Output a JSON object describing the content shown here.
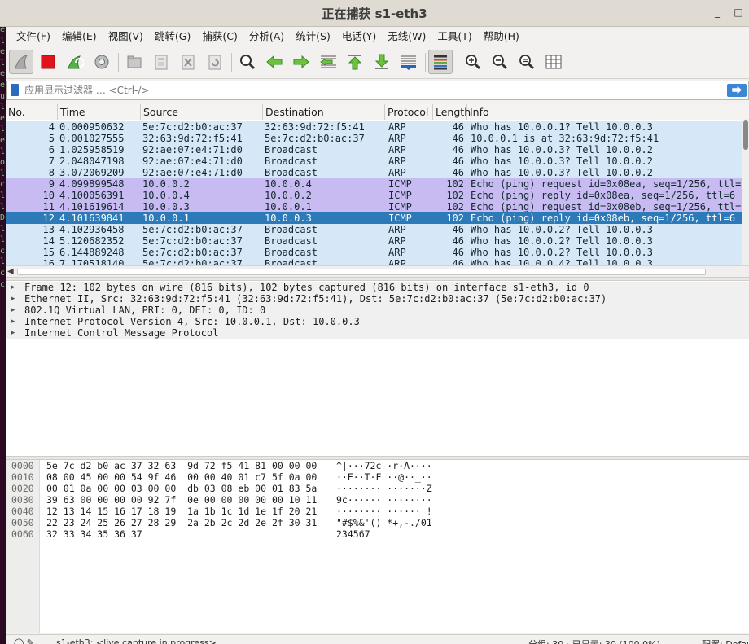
{
  "window": {
    "title": "正在捕获 s1-eth3",
    "minimize": "_",
    "close": "□"
  },
  "terminal_strip": [
    "e",
    "l",
    "e",
    "l",
    "e",
    "e",
    "",
    "u",
    "l",
    "e",
    "l",
    "e",
    "",
    "",
    "",
    "l",
    "",
    "",
    "",
    "o",
    "l",
    "c",
    "l",
    "",
    "l",
    "",
    "D",
    "l",
    "l",
    "c",
    "",
    "",
    "",
    "",
    "",
    "l",
    "c",
    "c",
    "",
    "",
    "",
    ""
  ],
  "menu": [
    {
      "label": "文件(F)"
    },
    {
      "label": "编辑(E)"
    },
    {
      "label": "视图(V)"
    },
    {
      "label": "跳转(G)"
    },
    {
      "label": "捕获(C)"
    },
    {
      "label": "分析(A)"
    },
    {
      "label": "统计(S)"
    },
    {
      "label": "电话(Y)"
    },
    {
      "label": "无线(W)"
    },
    {
      "label": "工具(T)"
    },
    {
      "label": "帮助(H)"
    }
  ],
  "toolbar": {
    "icons": [
      "start-capture-fin-icon",
      "stop-capture-icon",
      "restart-capture-icon",
      "capture-options-gear-icon",
      "open-file-icon",
      "save-file-icon",
      "close-file-icon",
      "reload-file-icon",
      "find-packet-icon",
      "go-back-icon",
      "go-forward-icon",
      "go-to-packet-icon",
      "go-first-icon",
      "go-last-icon",
      "autoscroll-icon",
      "colorize-icon",
      "zoom-in-icon",
      "zoom-out-icon",
      "zoom-normal-icon",
      "resize-columns-icon"
    ]
  },
  "filter": {
    "placeholder": "应用显示过滤器 … <Ctrl-/>",
    "apply_glyph": "⮕"
  },
  "packet_list": {
    "columns": [
      "No.",
      "Time",
      "Source",
      "Destination",
      "Protocol",
      "Length",
      "Info"
    ],
    "rows": [
      {
        "no": "4",
        "time": "0.000950632",
        "src": "5e:7c:d2:b0:ac:37",
        "dst": "32:63:9d:72:f5:41",
        "proto": "ARP",
        "len": "46",
        "info": "Who has 10.0.0.1? Tell 10.0.0.3",
        "kind": "arp"
      },
      {
        "no": "5",
        "time": "0.001027555",
        "src": "32:63:9d:72:f5:41",
        "dst": "5e:7c:d2:b0:ac:37",
        "proto": "ARP",
        "len": "46",
        "info": "10.0.0.1 is at 32:63:9d:72:f5:41",
        "kind": "arp"
      },
      {
        "no": "6",
        "time": "1.025958519",
        "src": "92:ae:07:e4:71:d0",
        "dst": "Broadcast",
        "proto": "ARP",
        "len": "46",
        "info": "Who has 10.0.0.3? Tell 10.0.0.2",
        "kind": "arp"
      },
      {
        "no": "7",
        "time": "2.048047198",
        "src": "92:ae:07:e4:71:d0",
        "dst": "Broadcast",
        "proto": "ARP",
        "len": "46",
        "info": "Who has 10.0.0.3? Tell 10.0.0.2",
        "kind": "arp"
      },
      {
        "no": "8",
        "time": "3.072069209",
        "src": "92:ae:07:e4:71:d0",
        "dst": "Broadcast",
        "proto": "ARP",
        "len": "46",
        "info": "Who has 10.0.0.3? Tell 10.0.0.2",
        "kind": "arp"
      },
      {
        "no": "9",
        "time": "4.099899548",
        "src": "10.0.0.2",
        "dst": "10.0.0.4",
        "proto": "ICMP",
        "len": "102",
        "info": "Echo (ping) request  id=0x08ea, seq=1/256, ttl=6",
        "kind": "icmp"
      },
      {
        "no": "10",
        "time": "4.100056391",
        "src": "10.0.0.4",
        "dst": "10.0.0.2",
        "proto": "ICMP",
        "len": "102",
        "info": "Echo (ping) reply    id=0x08ea, seq=1/256, ttl=6",
        "kind": "icmp"
      },
      {
        "no": "11",
        "time": "4.101619614",
        "src": "10.0.0.3",
        "dst": "10.0.0.1",
        "proto": "ICMP",
        "len": "102",
        "info": "Echo (ping) request  id=0x08eb, seq=1/256, ttl=6",
        "kind": "icmp"
      },
      {
        "no": "12",
        "time": "4.101639841",
        "src": "10.0.0.1",
        "dst": "10.0.0.3",
        "proto": "ICMP",
        "len": "102",
        "info": "Echo (ping) reply    id=0x08eb, seq=1/256, ttl=6",
        "kind": "sel"
      },
      {
        "no": "13",
        "time": "4.102936458",
        "src": "5e:7c:d2:b0:ac:37",
        "dst": "Broadcast",
        "proto": "ARP",
        "len": "46",
        "info": "Who has 10.0.0.2? Tell 10.0.0.3",
        "kind": "arp"
      },
      {
        "no": "14",
        "time": "5.120682352",
        "src": "5e:7c:d2:b0:ac:37",
        "dst": "Broadcast",
        "proto": "ARP",
        "len": "46",
        "info": "Who has 10.0.0.2? Tell 10.0.0.3",
        "kind": "arp"
      },
      {
        "no": "15",
        "time": "6.144889248",
        "src": "5e:7c:d2:b0:ac:37",
        "dst": "Broadcast",
        "proto": "ARP",
        "len": "46",
        "info": "Who has 10.0.0.2? Tell 10.0.0.3",
        "kind": "arp"
      },
      {
        "no": "16",
        "time": "7.170518140",
        "src": "5e:7c:d2:b0:ac:37",
        "dst": "Broadcast",
        "proto": "ARP",
        "len": "46",
        "info": "Who has 10.0.0.4? Tell 10.0.0.3",
        "kind": "arp"
      }
    ]
  },
  "details": [
    "Frame 12: 102 bytes on wire (816 bits), 102 bytes captured (816 bits) on interface s1-eth3, id 0",
    "Ethernet II, Src: 32:63:9d:72:f5:41 (32:63:9d:72:f5:41), Dst: 5e:7c:d2:b0:ac:37 (5e:7c:d2:b0:ac:37)",
    "802.1Q Virtual LAN, PRI: 0, DEI: 0, ID: 0",
    "Internet Protocol Version 4, Src: 10.0.0.1, Dst: 10.0.0.3",
    "Internet Control Message Protocol"
  ],
  "bytes": [
    {
      "off": "0000",
      "hex": "5e 7c d2 b0 ac 37 32 63  9d 72 f5 41 81 00 00 00",
      "ascii": "^|···72c ·r·A····"
    },
    {
      "off": "0010",
      "hex": "08 00 45 00 00 54 9f 46  00 00 40 01 c7 5f 0a 00",
      "ascii": "··E··T·F ··@··_··"
    },
    {
      "off": "0020",
      "hex": "00 01 0a 00 00 03 00 00  db 03 08 eb 00 01 83 5a",
      "ascii": "········ ·······Z"
    },
    {
      "off": "0030",
      "hex": "39 63 00 00 00 00 92 7f  0e 00 00 00 00 00 10 11",
      "ascii": "9c······ ········"
    },
    {
      "off": "0040",
      "hex": "12 13 14 15 16 17 18 19  1a 1b 1c 1d 1e 1f 20 21",
      "ascii": "········ ······ !"
    },
    {
      "off": "0050",
      "hex": "22 23 24 25 26 27 28 29  2a 2b 2c 2d 2e 2f 30 31",
      "ascii": "\"#$%&'() *+,-./01"
    },
    {
      "off": "0060",
      "hex": "32 33 34 35 36 37",
      "ascii": "234567"
    }
  ],
  "status": {
    "interface": "s1-eth3: <live capture in progress>",
    "counts": "分组: 30 · 已显示: 30 (100.0%)",
    "profile": "配置: Default"
  },
  "colors": {
    "arp_row": "#d6e8f8",
    "icmp_row": "#c7bbf2",
    "selected_row": "#2c7ab7"
  }
}
